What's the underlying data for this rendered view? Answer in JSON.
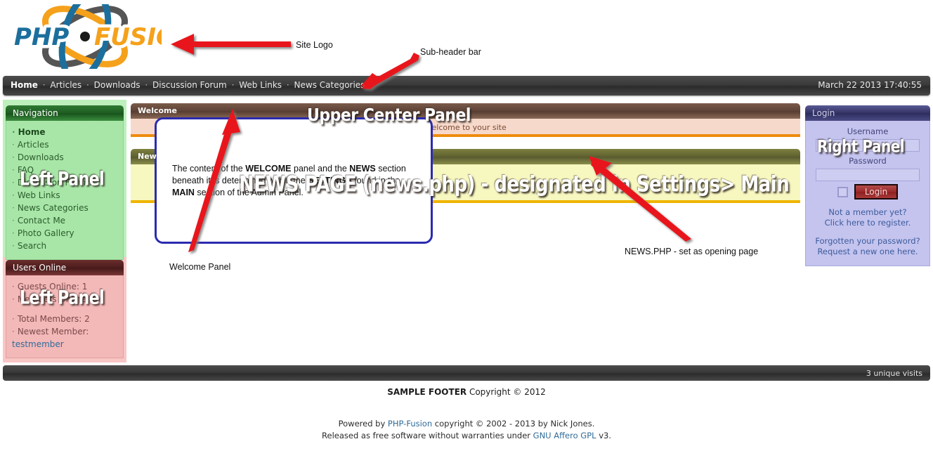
{
  "header": {
    "logo_text_php": "PHP",
    "logo_text_fusion": "FUSION",
    "logo_name": "PHP-Fusion site logo"
  },
  "subheader": {
    "items": [
      {
        "label": "Home",
        "active": true
      },
      {
        "label": "Articles",
        "active": false
      },
      {
        "label": "Downloads",
        "active": false
      },
      {
        "label": "Discussion Forum",
        "active": false
      },
      {
        "label": "Web Links",
        "active": false
      },
      {
        "label": "News Categories",
        "active": false
      }
    ],
    "separator": "·",
    "clock": "March 22 2013 17:40:55"
  },
  "left_panel": {
    "navigation": {
      "title": "Navigation",
      "items": [
        {
          "label": "Home",
          "bold": true
        },
        {
          "label": "Articles",
          "bold": false
        },
        {
          "label": "Downloads",
          "bold": false
        },
        {
          "label": "FAQ",
          "bold": false
        },
        {
          "label": "Discussion Forum",
          "bold": false
        },
        {
          "label": "Web Links",
          "bold": false
        },
        {
          "label": "News Categories",
          "bold": false
        },
        {
          "label": "Contact Me",
          "bold": false
        },
        {
          "label": "Photo Gallery",
          "bold": false
        },
        {
          "label": "Search",
          "bold": false
        }
      ],
      "bullet": "·"
    },
    "users_online": {
      "title": "Users Online",
      "guests_online": "Guests Online: 1",
      "members_online": "Members Online: 0",
      "total_members": "Total Members: 2",
      "newest_member_label": "Newest Member:",
      "newest_member_name": "testmember",
      "bullet": "·"
    }
  },
  "center": {
    "welcome": {
      "title": "Welcome",
      "body_text": "Welcome to your site"
    },
    "news": {
      "title": "News"
    },
    "content_box": {
      "line1_a": "The  content of the ",
      "line1_b": "WELCOME",
      "line1_c": " panel and the ",
      "line1_d": "NEWS",
      "line2_a": "section beneath it is determined within the ",
      "line2_b": "SETTINGS",
      "line3_a": "found in the ",
      "line3_b": "MAIN",
      "line3_c": " section of the Admin Panel."
    }
  },
  "right_panel": {
    "login": {
      "title": "Login",
      "username_label": "Username",
      "username_value": "",
      "username_placeholder": "",
      "password_label": "Password",
      "password_value": "",
      "password_placeholder": "",
      "remember_checkbox_checked": false,
      "login_button": "Login",
      "register_line1": "Not a member yet?",
      "register_line2": "Click here to register.",
      "forgot_line1": "Forgotten your password?",
      "forgot_line2": "Request a new one here."
    }
  },
  "footer": {
    "visits": "3 unique visits",
    "sample_bold": "SAMPLE FOOTER",
    "sample_rest": " Copyright © 2012",
    "credits_line1_a": "Powered by ",
    "credits_line1_link": "PHP-Fusion",
    "credits_line1_b": " copyright © 2002 - 2013 by Nick Jones.",
    "credits_line2_a": "Released as free software without warranties under ",
    "credits_line2_link": "GNU Affero GPL",
    "credits_line2_b": " v3."
  },
  "annotations": {
    "watermark_upper_center": "Upper Center Panel",
    "watermark_news_page": "NEWS PAGE (news.php) - designated in Settings> Main",
    "watermark_left_panel_1": "Left Panel",
    "watermark_left_panel_2": "Left Panel",
    "watermark_right_panel": "Right Panel",
    "label_site_logo": "Site Logo",
    "label_subheader_bar": "Sub-header bar",
    "label_welcome_panel": "Welcome Panel",
    "label_newsphp": "NEWS.PHP - set as opening page"
  },
  "colors": {
    "arrow_red": "#e8161a",
    "nav_bar_dark": "#3a3a3a",
    "green_panel": "#a8e6a8",
    "pink_panel": "#f3b8b8",
    "login_panel": "#c4c4ef",
    "welcome_body": "#f7d9cb",
    "news_body": "#f7f7c0",
    "orange_rule": "#ed8c0e",
    "yellow_rule": "#f0b400",
    "content_box_border": "#2b2bb0",
    "logo_blue": "#1c6f9c",
    "logo_orange": "#f5a11b",
    "logo_gray": "#555555"
  }
}
